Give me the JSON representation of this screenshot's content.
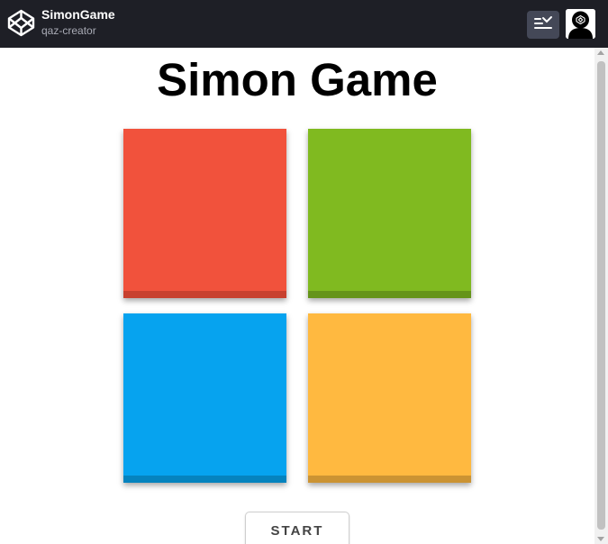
{
  "header": {
    "title": "SimonGame",
    "subtitle": "qaz-creator",
    "logo_icon": "codepen-logo-icon",
    "view_icon": "layout-view-icon",
    "avatar_icon": "user-avatar-icon"
  },
  "game": {
    "heading": "Simon Game",
    "pads": [
      {
        "color_name": "red",
        "color": "#f1523c"
      },
      {
        "color_name": "green",
        "color": "#80ba20"
      },
      {
        "color_name": "blue",
        "color": "#06a3ef"
      },
      {
        "color_name": "yellow",
        "color": "#ffb940"
      }
    ],
    "start_label": "START"
  },
  "colors": {
    "topbar_bg": "#1e1f26",
    "view_button_bg": "#444857"
  }
}
